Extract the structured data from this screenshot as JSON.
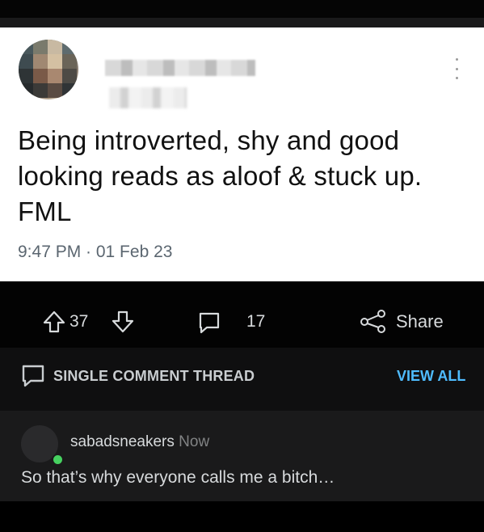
{
  "tweet": {
    "text": "Being introverted, shy and good looking reads as aloof & stuck up. FML",
    "timestamp": "9:47 PM · 01 Feb 23",
    "menu_icon": "more-vertical-icon"
  },
  "actions": {
    "upvote_icon": "upvote-arrow-icon",
    "vote_count": "37",
    "downvote_icon": "downvote-arrow-icon",
    "comment_icon": "comment-bubble-icon",
    "comment_count": "17",
    "share_icon": "share-icon",
    "share_label": "Share"
  },
  "thread": {
    "label": "SINGLE COMMENT THREAD",
    "view_all": "VIEW ALL"
  },
  "comment": {
    "username": "sabadsneakers",
    "time": "Now",
    "text": "So that’s why everyone calls me a bitch…",
    "online_color": "#46d160"
  },
  "colors": {
    "link": "#4fbcff",
    "tweet_bg": "#ffffff",
    "comment_bg": "#1a1a1b"
  }
}
